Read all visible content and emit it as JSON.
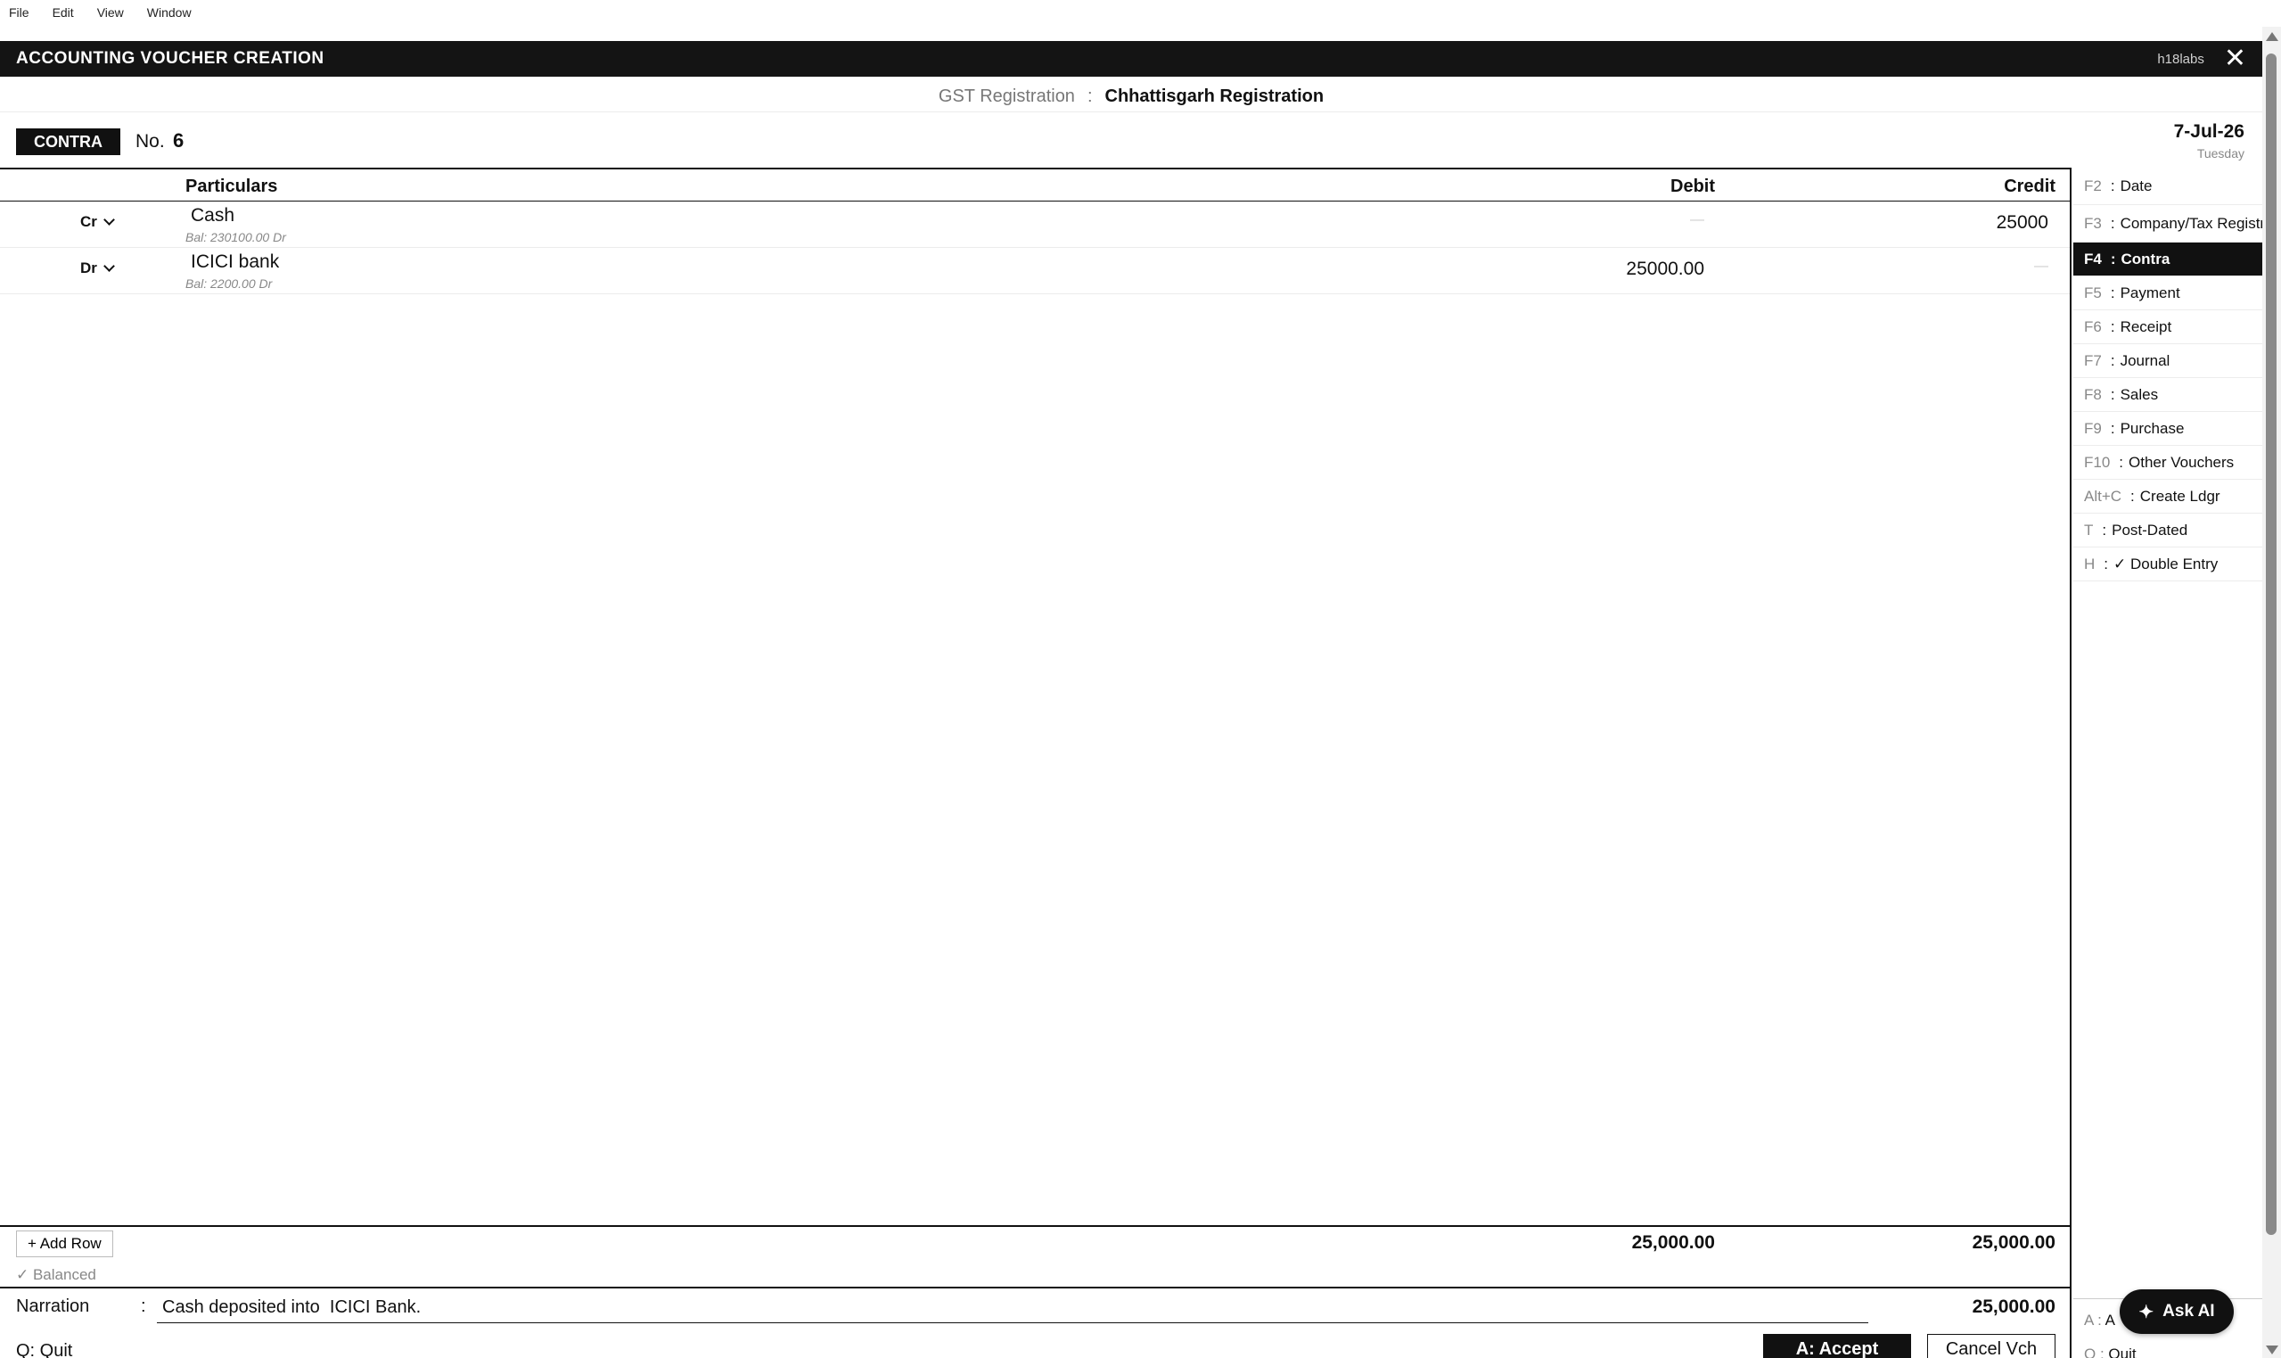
{
  "menu": [
    "File",
    "Edit",
    "View",
    "Window"
  ],
  "title_bar": {
    "title": "ACCOUNTING VOUCHER CREATION",
    "company": "h18labs",
    "close_glyph": "✕"
  },
  "gst": {
    "label": "GST Registration",
    "separator": ":",
    "value": "Chhattisgarh Registration"
  },
  "voucher": {
    "type": "CONTRA",
    "no_label": "No.",
    "no_value": "6",
    "date": "7-Jul-26",
    "day": "Tuesday"
  },
  "table": {
    "headers": {
      "particulars": "Particulars",
      "debit": "Debit",
      "credit": "Credit"
    },
    "rows": [
      {
        "crdr": "Cr",
        "name": "Cash",
        "balance": "Bal: 230100.00 Dr",
        "debit": "—",
        "credit": "25000"
      },
      {
        "crdr": "Dr",
        "name": "ICICI bank",
        "balance": "Bal: 2200.00 Dr",
        "debit": "25000.00",
        "credit": "—"
      }
    ]
  },
  "sidebar": [
    {
      "key": "F2",
      "label": "Date"
    },
    {
      "key": "F3",
      "label": "Company/Tax Registration"
    },
    {
      "key": "F4",
      "label": "Contra",
      "active": true
    },
    {
      "key": "F5",
      "label": "Payment"
    },
    {
      "key": "F6",
      "label": "Receipt"
    },
    {
      "key": "F7",
      "label": "Journal"
    },
    {
      "key": "F8",
      "label": "Sales"
    },
    {
      "key": "F9",
      "label": "Purchase"
    },
    {
      "key": "F10",
      "label": "Other Vouchers"
    },
    {
      "key": "Alt+C",
      "label": "Create Ldgr"
    },
    {
      "key": "T",
      "label": "Post-Dated"
    },
    {
      "key": "H",
      "label": "✓ Double Entry"
    }
  ],
  "sidebar_bottom": {
    "accept_key": "A",
    "accept_label": "A",
    "quit_key": "Q",
    "quit_label": "Quit"
  },
  "footer": {
    "add_row": "+ Add Row",
    "total_debit": "25,000.00",
    "total_credit": "25,000.00",
    "balanced": "✓ Balanced",
    "narration_label": "Narration",
    "narration_colon": ":",
    "narration_value": "Cash deposited into  ICICI Bank.",
    "narration_total": "25,000.00",
    "quit": "Q: Quit",
    "accept": "A: Accept",
    "cancel": "Cancel Vch"
  },
  "ask_ai": {
    "icon": "✦",
    "label": "Ask AI"
  }
}
